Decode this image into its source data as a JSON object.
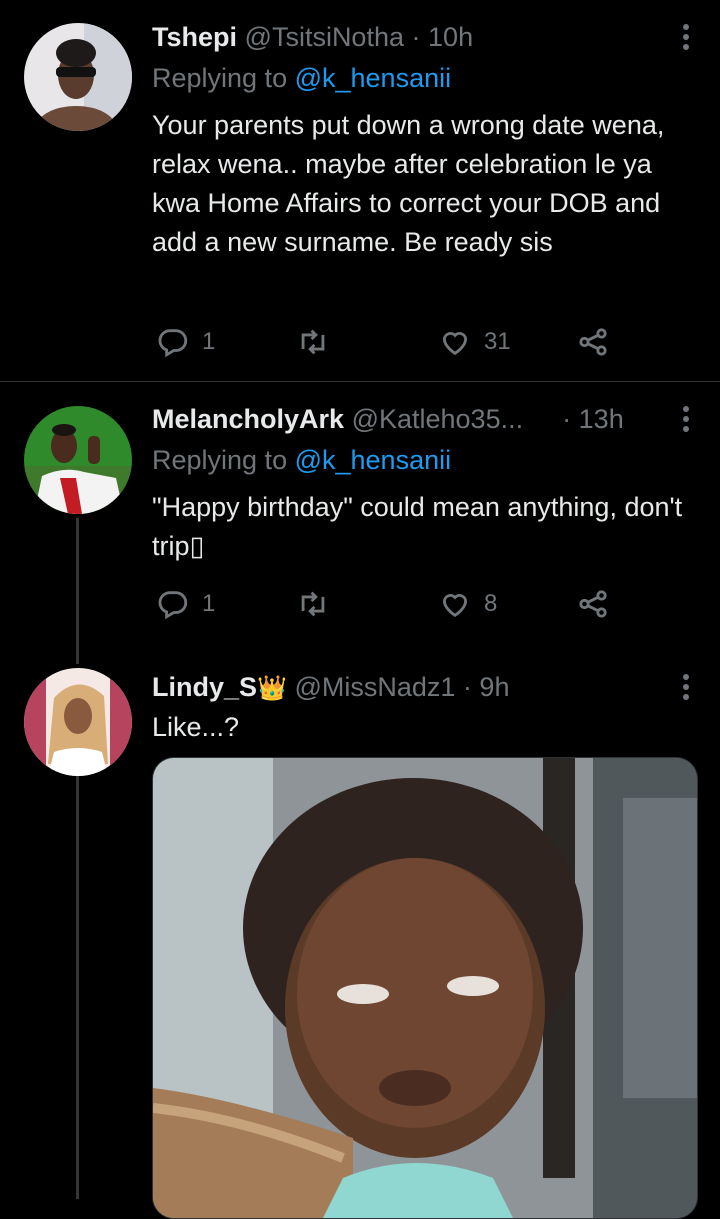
{
  "tweets": [
    {
      "name": "Tshepi",
      "handle": "@TsitsiNotha",
      "dot": "·",
      "time": "10h",
      "replying_prefix": "Replying to ",
      "replying_handle": "@k_hensanii",
      "text": "Your parents put down a wrong date wena, relax wena.. maybe after celebration le ya kwa Home Affairs to correct your DOB and add a new surname. Be ready sis",
      "reply_count": "1",
      "like_count": "31"
    },
    {
      "name": "MelancholyArk",
      "handle": "@Katleho35...",
      "dot": "·",
      "time": "13h",
      "replying_prefix": "Replying to ",
      "replying_handle": "@k_hensanii",
      "text": "\"Happy birthday\" could mean anything, don't trip▯",
      "reply_count": "1",
      "like_count": "8"
    },
    {
      "name": "Lindy_S",
      "name_emoji": "👑",
      "handle": "@MissNadz1",
      "dot": "·",
      "time": "9h",
      "text": "Like...?"
    }
  ],
  "colors": {
    "background": "#000000",
    "primary_text": "#e7e9ea",
    "secondary_text": "#71767b",
    "link": "#1d9bf0",
    "divider": "#2f3336"
  },
  "icons": [
    "reply-icon",
    "retweet-icon",
    "like-icon",
    "share-icon",
    "more-icon"
  ]
}
